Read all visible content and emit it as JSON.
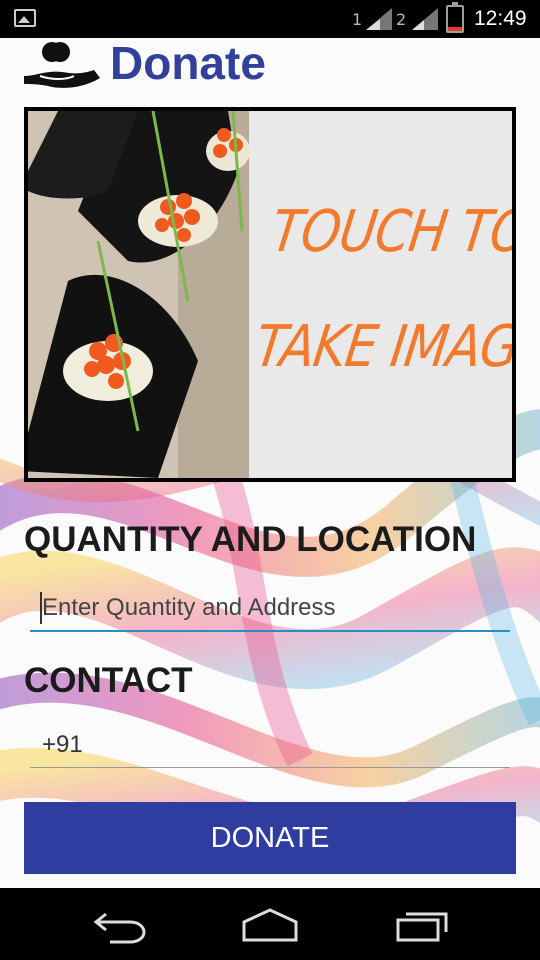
{
  "status_bar": {
    "sim1_label": "1",
    "sim2_label": "2",
    "time": "12:49",
    "icons": [
      "gallery-notification-icon",
      "signal-icon",
      "signal-icon",
      "battery-low-icon"
    ]
  },
  "header": {
    "title": "Donate",
    "logo_icon": "hand-with-apple-icon"
  },
  "image_picker": {
    "line1": "TOUCH TO",
    "line2": "TAKE IMAGE",
    "accent_color": "#f27a2d"
  },
  "quantity_section": {
    "label": "QUANTITY AND LOCATION",
    "placeholder": "Enter Quantity and Address"
  },
  "contact_section": {
    "label": "CONTACT",
    "value": "+91"
  },
  "donate_button": {
    "label": "DONATE"
  },
  "nav_bar": {
    "icons": [
      "back-icon",
      "home-icon",
      "recents-icon"
    ]
  },
  "colors": {
    "brand": "#31409a",
    "button": "#2f3da0",
    "input_focus_line": "#2a8fbd"
  }
}
